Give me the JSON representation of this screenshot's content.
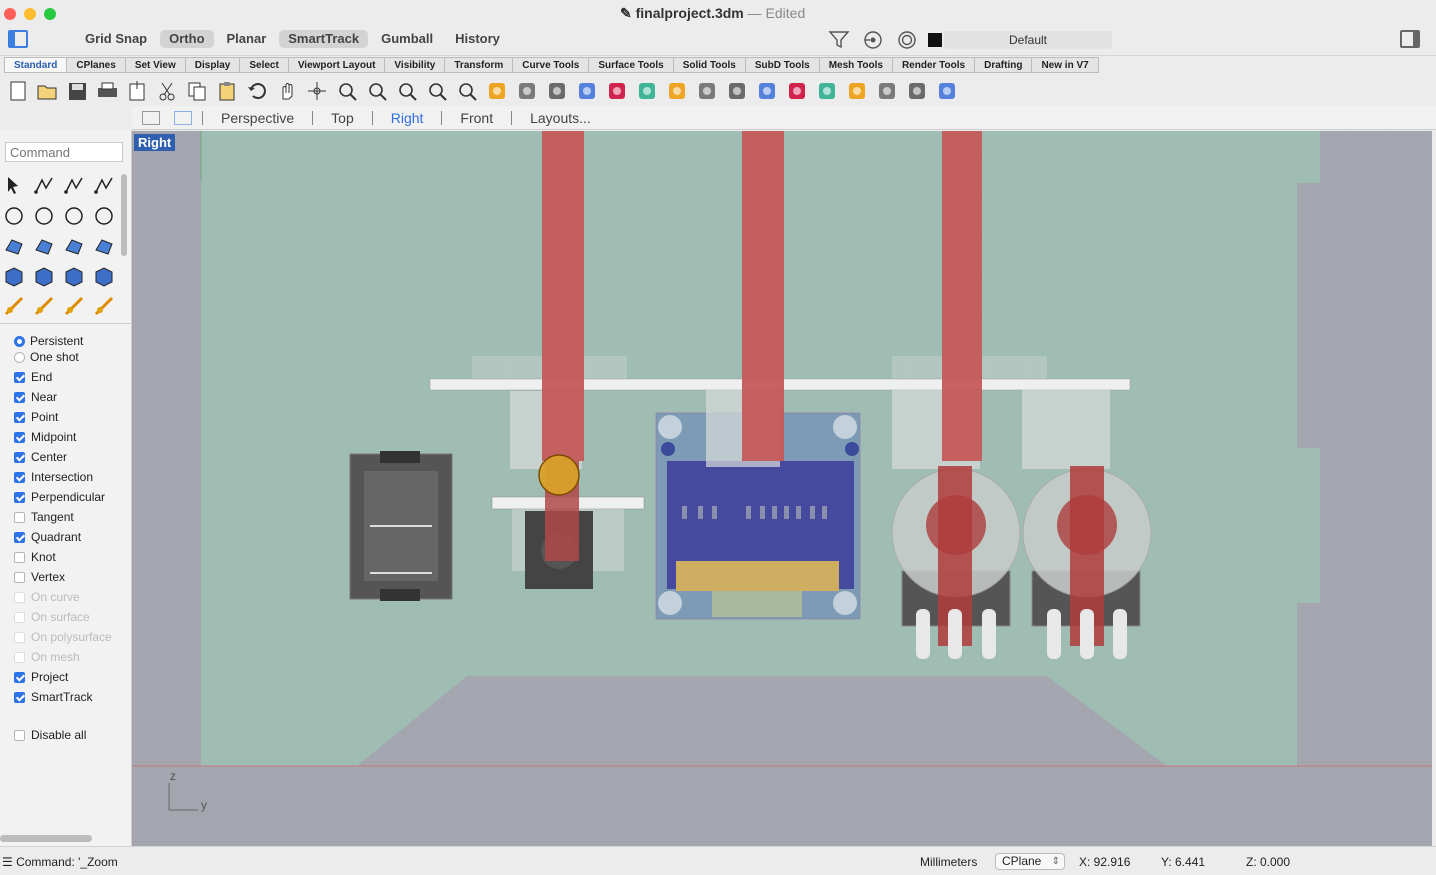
{
  "window": {
    "title": "finalproject.3dm",
    "status": "— Edited"
  },
  "modes": [
    {
      "label": "Grid Snap",
      "on": false
    },
    {
      "label": "Ortho",
      "on": true
    },
    {
      "label": "Planar",
      "on": false
    },
    {
      "label": "SmartTrack",
      "on": true
    },
    {
      "label": "Gumball",
      "on": false
    },
    {
      "label": "History",
      "on": false
    }
  ],
  "layer": {
    "name": "Default",
    "color": "#111111"
  },
  "tabs": [
    "Standard",
    "CPlanes",
    "Set View",
    "Display",
    "Select",
    "Viewport Layout",
    "Visibility",
    "Transform",
    "Curve Tools",
    "Surface Tools",
    "Solid Tools",
    "SubD Tools",
    "Mesh Tools",
    "Render Tools",
    "Drafting",
    "New in V7"
  ],
  "toolbar_icons": [
    "new-icon",
    "open-icon",
    "save-icon",
    "print-icon",
    "import-icon",
    "cut-icon",
    "copy-icon",
    "paste-icon",
    "undo-icon",
    "pan-icon",
    "rotate-view-icon",
    "zoom-icon",
    "zoom-window-icon",
    "zoom-extents-icon",
    "zoom-selected-icon",
    "zoom-target-icon",
    "viewport-grid-icon",
    "car-icon",
    "render-icon",
    "snapshot-icon",
    "point-select-icon",
    "light-icon",
    "lock-icon",
    "layer-icon",
    "color-wheel-icon",
    "shade-icon",
    "wire-icon",
    "sphere-icon",
    "filter-icon",
    "dimension-icon",
    "globe-icon",
    "help-icon"
  ],
  "view_tabs": [
    "Perspective",
    "Top",
    "Right",
    "Front",
    "Layouts..."
  ],
  "active_view": "Right",
  "command": {
    "placeholder": "Command"
  },
  "snap_mode": [
    {
      "label": "Persistent",
      "on": true
    },
    {
      "label": "One shot",
      "on": false
    }
  ],
  "osnaps": [
    {
      "label": "End",
      "on": true,
      "enabled": true
    },
    {
      "label": "Near",
      "on": true,
      "enabled": true
    },
    {
      "label": "Point",
      "on": true,
      "enabled": true
    },
    {
      "label": "Midpoint",
      "on": true,
      "enabled": true
    },
    {
      "label": "Center",
      "on": true,
      "enabled": true
    },
    {
      "label": "Intersection",
      "on": true,
      "enabled": true
    },
    {
      "label": "Perpendicular",
      "on": true,
      "enabled": true
    },
    {
      "label": "Tangent",
      "on": false,
      "enabled": true
    },
    {
      "label": "Quadrant",
      "on": true,
      "enabled": true
    },
    {
      "label": "Knot",
      "on": false,
      "enabled": true
    },
    {
      "label": "Vertex",
      "on": false,
      "enabled": true
    },
    {
      "label": "On curve",
      "on": false,
      "enabled": false
    },
    {
      "label": "On surface",
      "on": false,
      "enabled": false
    },
    {
      "label": "On polysurface",
      "on": false,
      "enabled": false
    },
    {
      "label": "On mesh",
      "on": false,
      "enabled": false
    },
    {
      "label": "Project",
      "on": true,
      "enabled": true
    },
    {
      "label": "SmartTrack",
      "on": true,
      "enabled": true
    }
  ],
  "disable_all": "Disable all",
  "axes": {
    "vertical": "z",
    "horizontal": "y"
  },
  "status": {
    "command": "Command: '_Zoom",
    "units": "Millimeters",
    "cplane": "CPlane",
    "x": "X: 92.916",
    "y": "Y: 6.441",
    "z": "Z: 0.000"
  }
}
